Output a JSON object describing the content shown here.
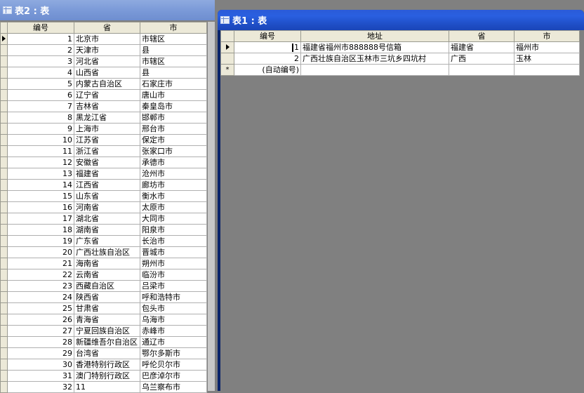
{
  "window2": {
    "title": "表2 : 表",
    "columns": [
      "编号",
      "省",
      "市"
    ],
    "rows": [
      [
        "1",
        "北京市",
        "市辖区"
      ],
      [
        "2",
        "天津市",
        "县"
      ],
      [
        "3",
        "河北省",
        "市辖区"
      ],
      [
        "4",
        "山西省",
        "县"
      ],
      [
        "5",
        "内蒙古自治区",
        "石家庄市"
      ],
      [
        "6",
        "辽宁省",
        "唐山市"
      ],
      [
        "7",
        "吉林省",
        "秦皇岛市"
      ],
      [
        "8",
        "黑龙江省",
        "邯郸市"
      ],
      [
        "9",
        "上海市",
        "邢台市"
      ],
      [
        "10",
        "江苏省",
        "保定市"
      ],
      [
        "11",
        "浙江省",
        "张家口市"
      ],
      [
        "12",
        "安徽省",
        "承德市"
      ],
      [
        "13",
        "福建省",
        "沧州市"
      ],
      [
        "14",
        "江西省",
        "廊坊市"
      ],
      [
        "15",
        "山东省",
        "衡水市"
      ],
      [
        "16",
        "河南省",
        "太原市"
      ],
      [
        "17",
        "湖北省",
        "大同市"
      ],
      [
        "18",
        "湖南省",
        "阳泉市"
      ],
      [
        "19",
        "广东省",
        "长治市"
      ],
      [
        "20",
        "广西壮族自治区",
        "晋城市"
      ],
      [
        "21",
        "海南省",
        "朔州市"
      ],
      [
        "22",
        "云南省",
        "临汾市"
      ],
      [
        "23",
        "西藏自治区",
        "吕梁市"
      ],
      [
        "24",
        "陕西省",
        "呼和浩特市"
      ],
      [
        "25",
        "甘肃省",
        "包头市"
      ],
      [
        "26",
        "青海省",
        "乌海市"
      ],
      [
        "27",
        "宁夏回族自治区",
        "赤峰市"
      ],
      [
        "28",
        "新疆维吾尔自治区",
        "通辽市"
      ],
      [
        "29",
        "台湾省",
        "鄂尔多斯市"
      ],
      [
        "30",
        "香港特别行政区",
        "呼伦贝尔市"
      ],
      [
        "31",
        "澳门特别行政区",
        "巴彦淖尔市"
      ],
      [
        "32",
        "11",
        "乌兰察布市"
      ]
    ]
  },
  "window1": {
    "title": "表1 : 表",
    "columns": [
      "编号",
      "地址",
      "省",
      "市"
    ],
    "rows": [
      [
        "1",
        "福建省福州市888888号信箱",
        "福建省",
        "福州市"
      ],
      [
        "2",
        "广西壮族自治区玉林市三坑乡四坑村",
        "广西",
        "玉林"
      ]
    ],
    "new_row": "(自动编号)",
    "new_row_marker": "*"
  }
}
